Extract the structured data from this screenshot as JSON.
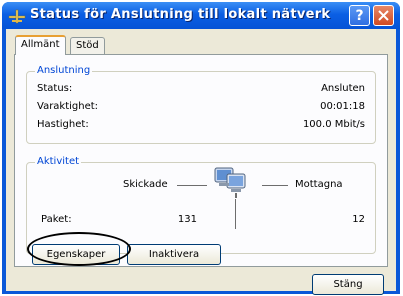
{
  "window": {
    "title": "Status för Anslutning till lokalt nätverk",
    "help_glyph": "?",
    "close_glyph": "✕"
  },
  "tabs": [
    {
      "label": "Allmänt",
      "active": true
    },
    {
      "label": "Stöd",
      "active": false
    }
  ],
  "connection": {
    "group_title": "Anslutning",
    "rows": [
      {
        "label": "Status:",
        "value": "Ansluten"
      },
      {
        "label": "Varaktighet:",
        "value": "00:01:18"
      },
      {
        "label": "Hastighet:",
        "value": "100.0 Mbit/s"
      }
    ]
  },
  "activity": {
    "group_title": "Aktivitet",
    "sent_label": "Skickade",
    "received_label": "Mottagna",
    "packets_label": "Paket:",
    "packets_sent": "131",
    "packets_received": "12"
  },
  "buttons": {
    "properties": "Egenskaper",
    "disable": "Inaktivera",
    "close": "Stäng"
  },
  "colors": {
    "titlebar": "#0553d6",
    "group_title": "#0046d5",
    "annotation": "#000000"
  }
}
